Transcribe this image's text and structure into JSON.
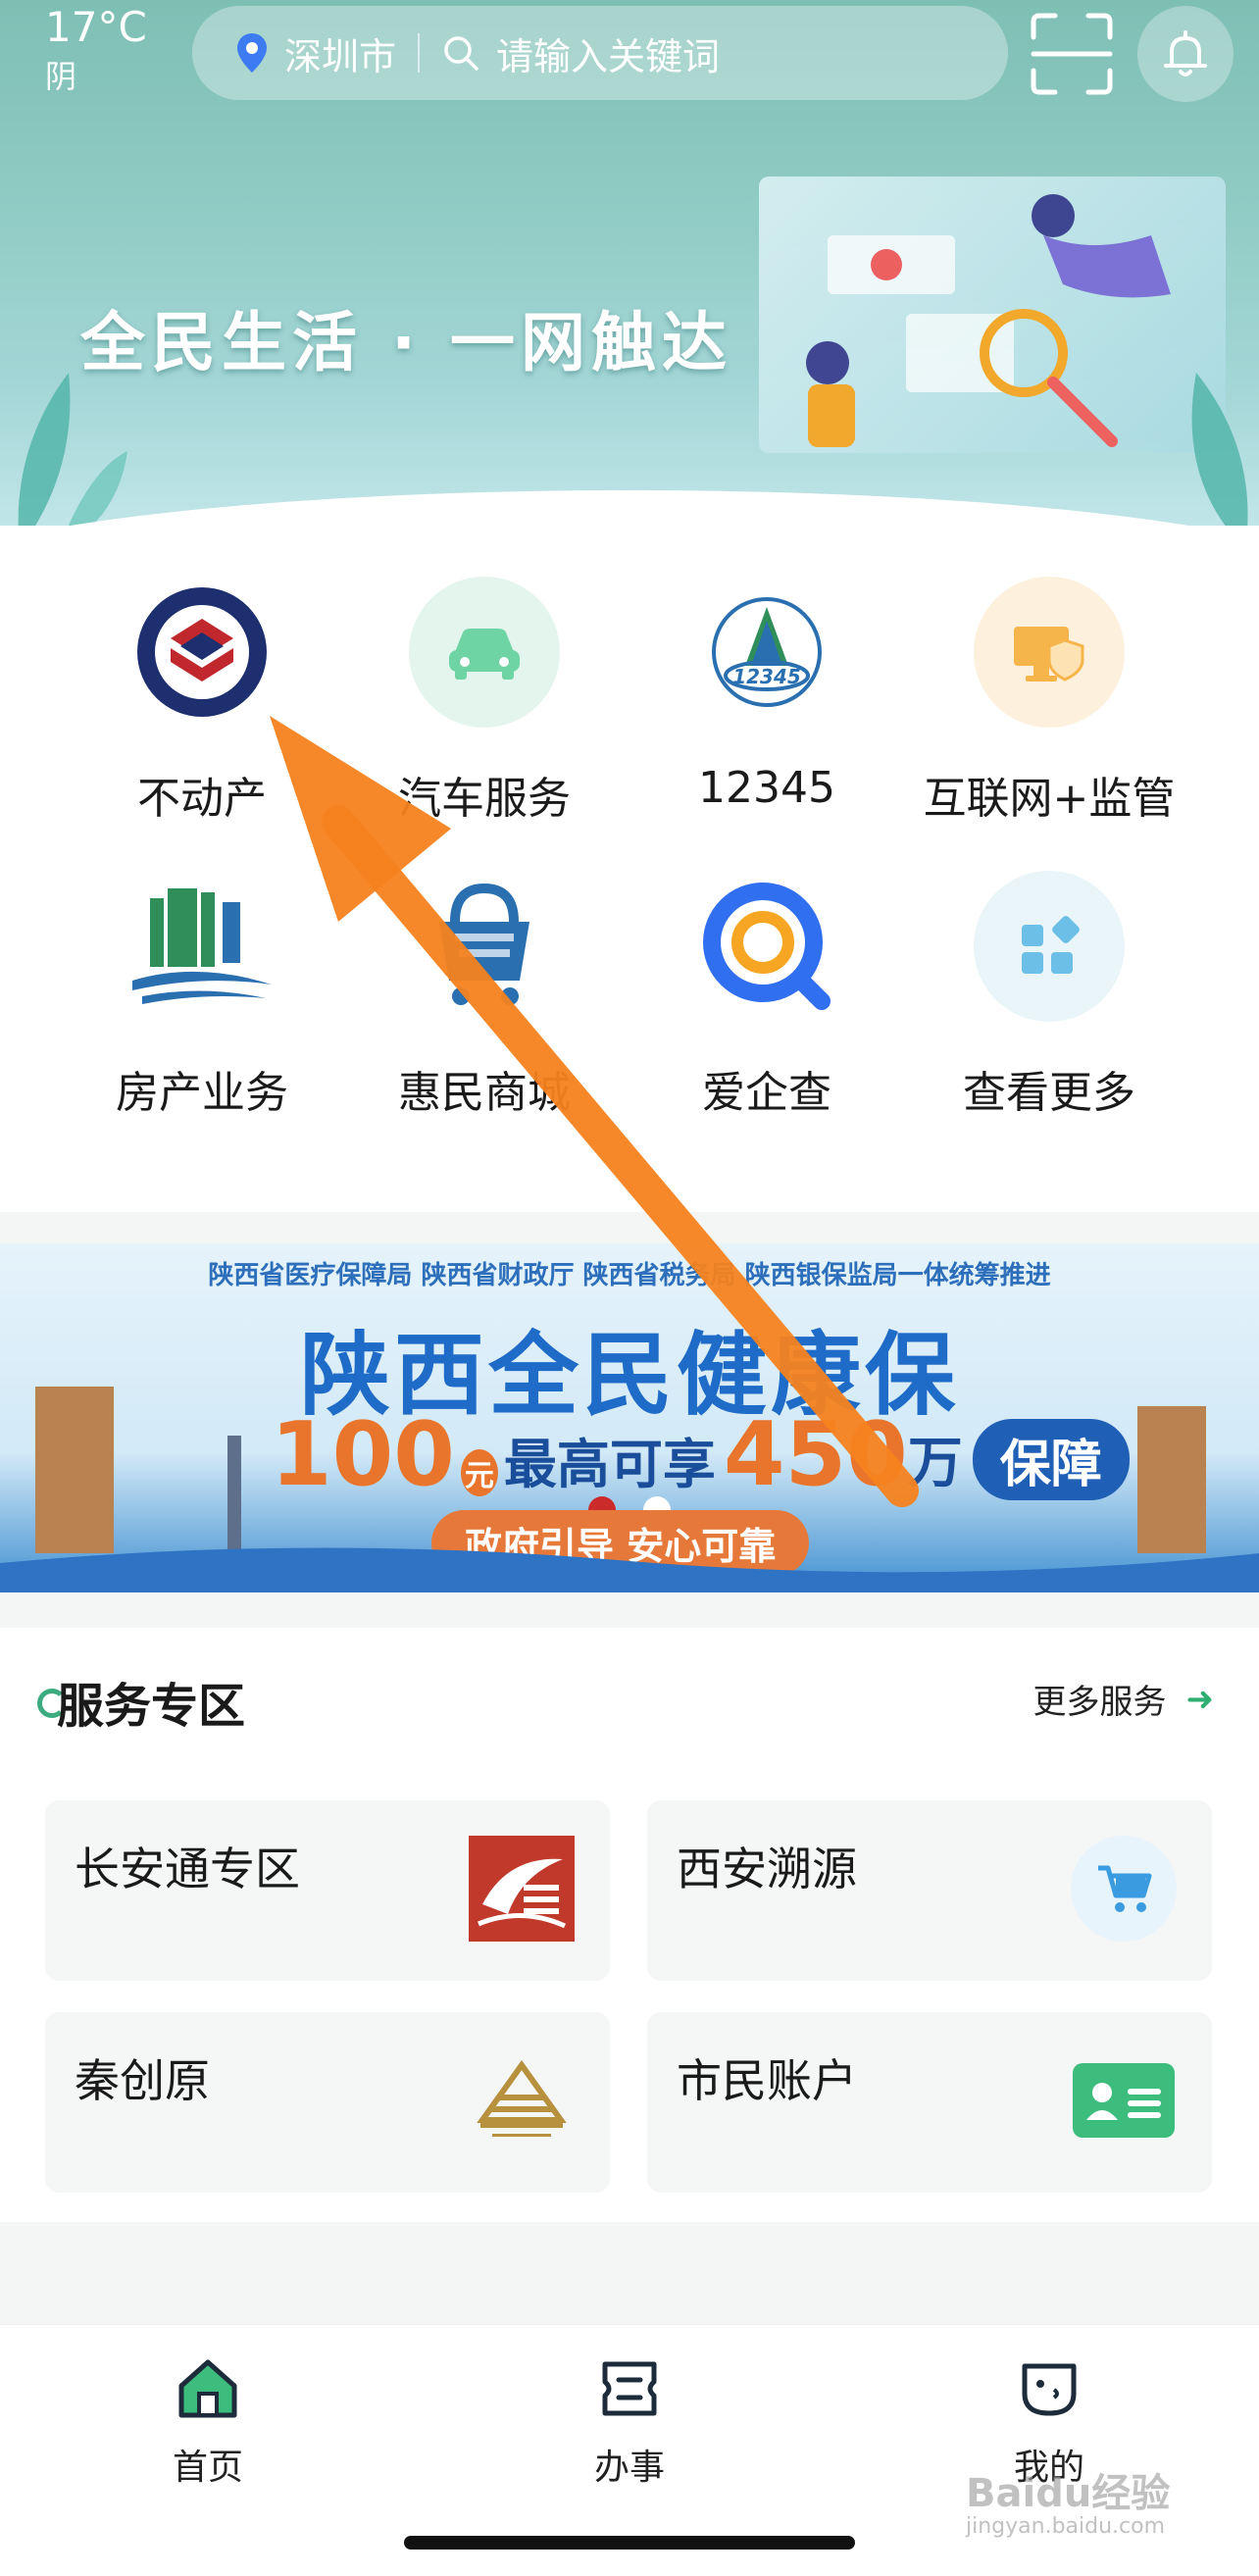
{
  "status": {
    "temperature": "17°C",
    "condition": "阴"
  },
  "search": {
    "city": "深圳市",
    "placeholder": "请输入关键词"
  },
  "hero": {
    "slogan": "全民生活 · 一网触达"
  },
  "grid": [
    {
      "label": "不动产",
      "icon": "real-estate-registration-logo"
    },
    {
      "label": "汽车服务",
      "icon": "car-icon"
    },
    {
      "label": "12345",
      "icon": "hotline-12345-logo"
    },
    {
      "label": "互联网+监管",
      "icon": "monitor-shield-icon"
    },
    {
      "label": "房产业务",
      "icon": "housing-logo"
    },
    {
      "label": "惠民商城",
      "icon": "shopping-cart-icon"
    },
    {
      "label": "爱企查",
      "icon": "magnifier-logo"
    },
    {
      "label": "查看更多",
      "icon": "grid-more-icon"
    }
  ],
  "banner": {
    "agencies": "陕西省医疗保障局  陕西省财政厅  陕西省税务局  陕西银保监局一体统筹推进",
    "title": "陕西全民健康保",
    "price": "100",
    "price_unit": "元",
    "mid_text": "最高可享",
    "max_amount": "450",
    "max_unit": "万",
    "tag": "保障",
    "slogan": "政府引导 安心可靠"
  },
  "service": {
    "title": "服务专区",
    "more": "更多服务",
    "cards": [
      {
        "label": "长安通专区",
        "icon": "changantong-logo"
      },
      {
        "label": "西安溯源",
        "icon": "shopping-cart-icon"
      },
      {
        "label": "秦创原",
        "icon": "qinchuangyuan-logo"
      },
      {
        "label": "市民账户",
        "icon": "id-card-icon"
      }
    ]
  },
  "tabs": [
    {
      "label": "首页",
      "icon": "home-icon"
    },
    {
      "label": "办事",
      "icon": "service-icon"
    },
    {
      "label": "我的",
      "icon": "profile-icon"
    }
  ],
  "watermark": {
    "brand": "Baidu经验",
    "url": "jingyan.baidu.com"
  },
  "colors": {
    "primary_green": "#2fae72",
    "arrow_orange": "#f5821f",
    "hero_teal": "#8fcac3"
  }
}
